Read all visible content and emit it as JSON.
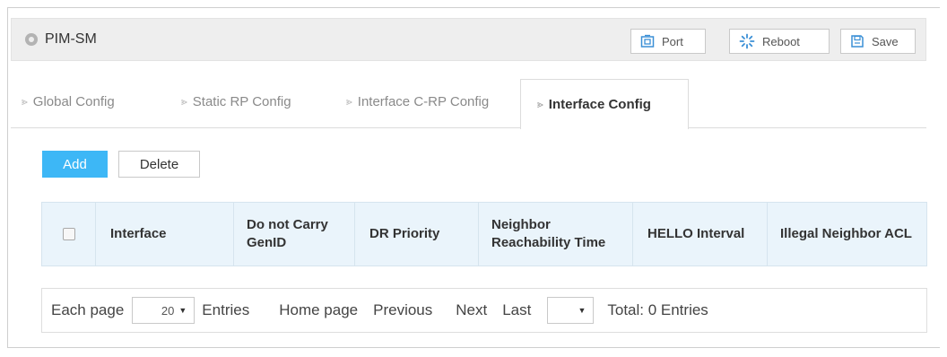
{
  "header": {
    "title": "PIM-SM",
    "buttons": {
      "port": "Port",
      "reboot": "Reboot",
      "save": "Save"
    }
  },
  "tabs": [
    {
      "label": "Global Config",
      "active": false
    },
    {
      "label": "Static RP Config",
      "active": false
    },
    {
      "label": "Interface C-RP Config",
      "active": false
    },
    {
      "label": "Interface Config",
      "active": true
    }
  ],
  "actions": {
    "add": "Add",
    "delete": "Delete"
  },
  "table": {
    "columns": [
      "Interface",
      "Do not Carry GenID",
      "DR Priority",
      "Neighbor Reachability Time",
      "HELLO Interval",
      "Illegal Neighbor ACL"
    ],
    "rows": []
  },
  "pagination": {
    "each_page": "Each page",
    "page_size": "20",
    "entries": "Entries",
    "home": "Home page",
    "previous": "Previous",
    "next": "Next",
    "last": "Last",
    "current_page": "",
    "total": "Total: 0 Entries"
  },
  "colors": {
    "accent": "#3db7f6",
    "header_bg": "#eeeeee",
    "table_header_bg": "#eaf4fb"
  },
  "icons": [
    "status-dot-icon",
    "port-icon",
    "reboot-icon",
    "save-icon",
    "tab-arrow-icon",
    "caret-down-icon"
  ]
}
